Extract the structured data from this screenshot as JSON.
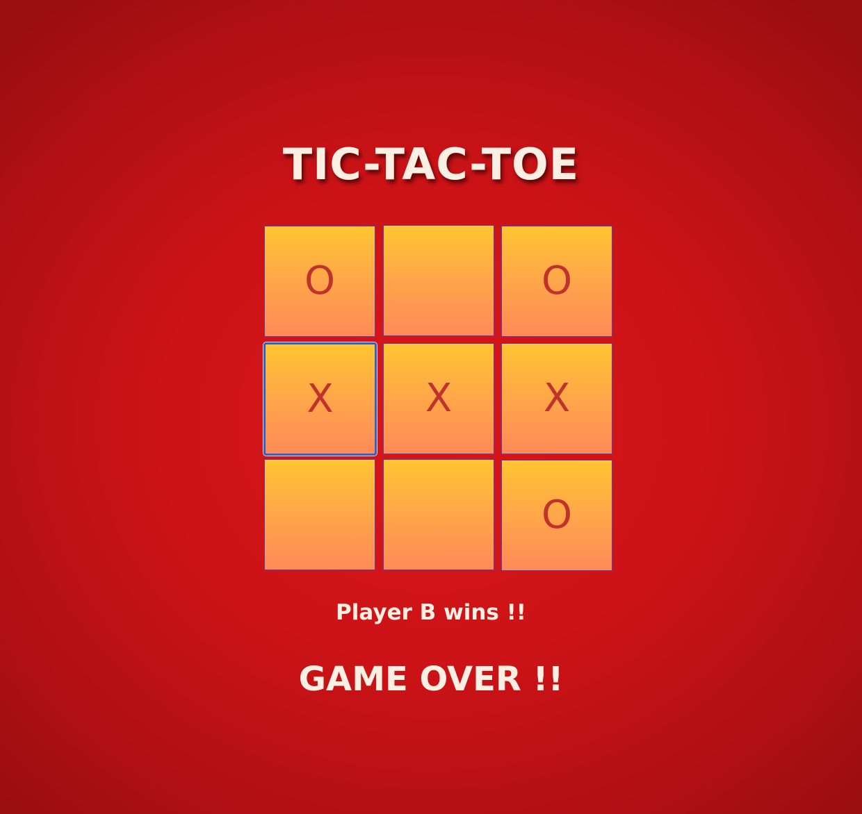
{
  "game": {
    "title": "TIC-TAC-TOE",
    "board": [
      {
        "mark": "O"
      },
      {
        "mark": ""
      },
      {
        "mark": "O"
      },
      {
        "mark": "X"
      },
      {
        "mark": "X"
      },
      {
        "mark": "X"
      },
      {
        "mark": ""
      },
      {
        "mark": ""
      },
      {
        "mark": "O"
      }
    ],
    "focused_cell": 3,
    "status": "Player B wins !!",
    "game_over": "GAME OVER !!"
  },
  "colors": {
    "background": "#cc1317",
    "cell_top": "#ffc531",
    "cell_bottom": "#ff8a58",
    "mark": "#c0322c",
    "text": "#fbeee2",
    "focus_ring": "#2f63c9"
  }
}
